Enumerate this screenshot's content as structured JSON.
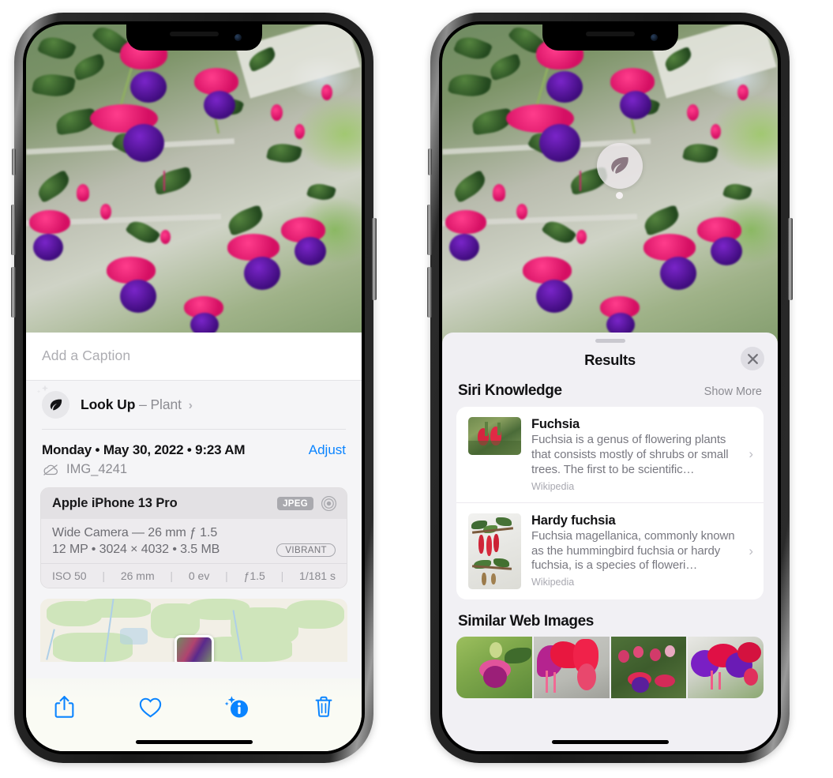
{
  "left_phone": {
    "caption": {
      "placeholder": "Add a Caption",
      "value": ""
    },
    "lookup": {
      "label": "Look Up",
      "dash": "–",
      "subject": "Plant",
      "chevron": "›",
      "icon": "leaf-icon"
    },
    "meta": {
      "datetime": "Monday • May 30, 2022 • 9:23 AM",
      "adjust_label": "Adjust",
      "filename": "IMG_4241",
      "cloud_icon": "icloud-slash-icon"
    },
    "camera": {
      "model": "Apple iPhone 13 Pro",
      "format_badge": "JPEG",
      "aperture_icon": "aperture-icon",
      "lens": "Wide Camera — 26 mm ƒ 1.5",
      "resolution": "12 MP • 3024 × 4032 • 3.5 MB",
      "style_badge": "VIBRANT",
      "exif": [
        "ISO 50",
        "26 mm",
        "0 ev",
        "ƒ1.5",
        "1/181 s"
      ]
    },
    "toolbar": [
      {
        "name": "share-button",
        "icon": "share-icon"
      },
      {
        "name": "favorite-button",
        "icon": "heart-icon"
      },
      {
        "name": "info-button",
        "icon": "sparkle-info-icon"
      },
      {
        "name": "delete-button",
        "icon": "trash-icon"
      }
    ],
    "map": {
      "name": "location-map-thumbnail",
      "pin": "photo-pin"
    }
  },
  "right_phone": {
    "badge": {
      "icon": "leaf-icon",
      "name": "visual-lookup-badge"
    },
    "sheet": {
      "title": "Results",
      "close_label": "✕",
      "sections": [
        {
          "title": "Siri Knowledge",
          "action_label": "Show More",
          "items": [
            {
              "title": "Fuchsia",
              "description": "Fuchsia is a genus of flowering plants that consists mostly of shrubs or small trees. The first to be scientific…",
              "source": "Wikipedia",
              "chevron": "›"
            },
            {
              "title": "Hardy fuchsia",
              "description": "Fuchsia magellanica, commonly known as the hummingbird fuchsia or hardy fuchsia, is a species of floweri…",
              "source": "Wikipedia",
              "chevron": "›"
            }
          ]
        },
        {
          "title": "Similar Web Images",
          "thumbnails": [
            "web-image-1",
            "web-image-2",
            "web-image-3",
            "web-image-4"
          ]
        }
      ]
    }
  },
  "colors": {
    "accent_blue": "#0a84ff",
    "sheet_gray": "#f1f0f4",
    "card_white": "#ffffff",
    "secondary_text": "#8c8c92"
  }
}
